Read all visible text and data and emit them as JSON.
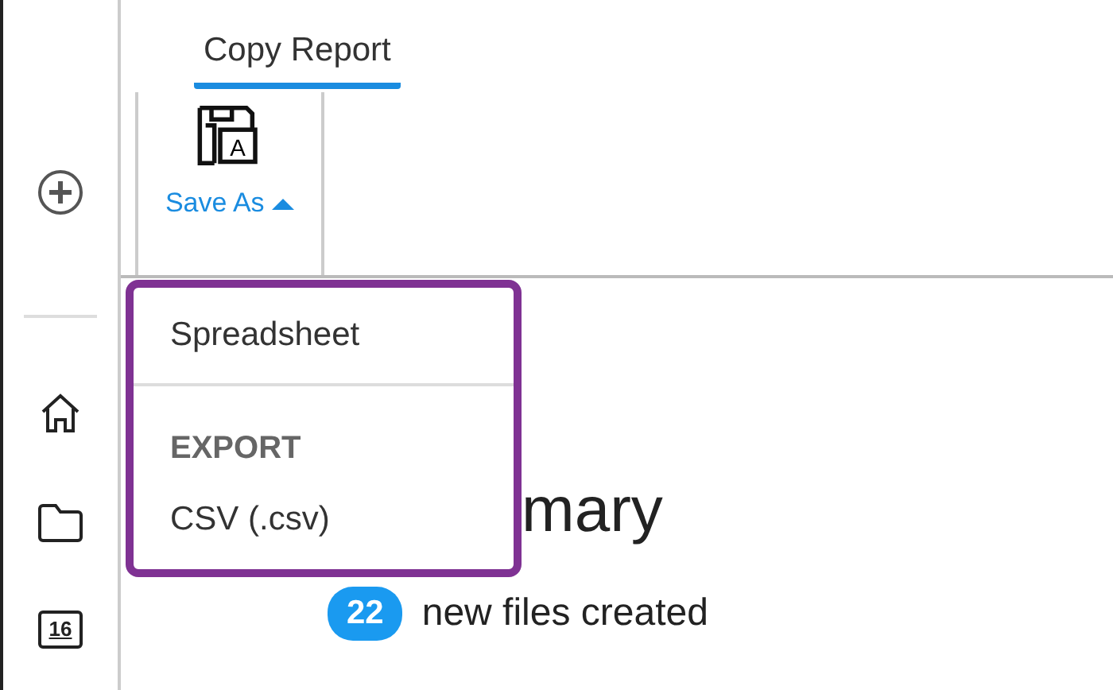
{
  "sidebar": {
    "items": [
      {
        "kind": "add"
      },
      {
        "kind": "divider"
      },
      {
        "kind": "home"
      },
      {
        "kind": "folder"
      },
      {
        "kind": "calendar",
        "label": "16"
      }
    ]
  },
  "tabs": [
    {
      "label": "Copy Report",
      "selected": true
    }
  ],
  "toolbar": {
    "buttons": [
      {
        "label": "Save As",
        "icon_letter": "A",
        "expanded": true
      }
    ]
  },
  "menu": {
    "items": [
      {
        "kind": "item",
        "label": "Spreadsheet"
      },
      {
        "kind": "divider"
      },
      {
        "kind": "header",
        "label": "EXPORT"
      },
      {
        "kind": "item",
        "label": "CSV (.csv)"
      }
    ]
  },
  "content": {
    "heading": "mary",
    "badge": "22",
    "badge_text": "new files created"
  }
}
